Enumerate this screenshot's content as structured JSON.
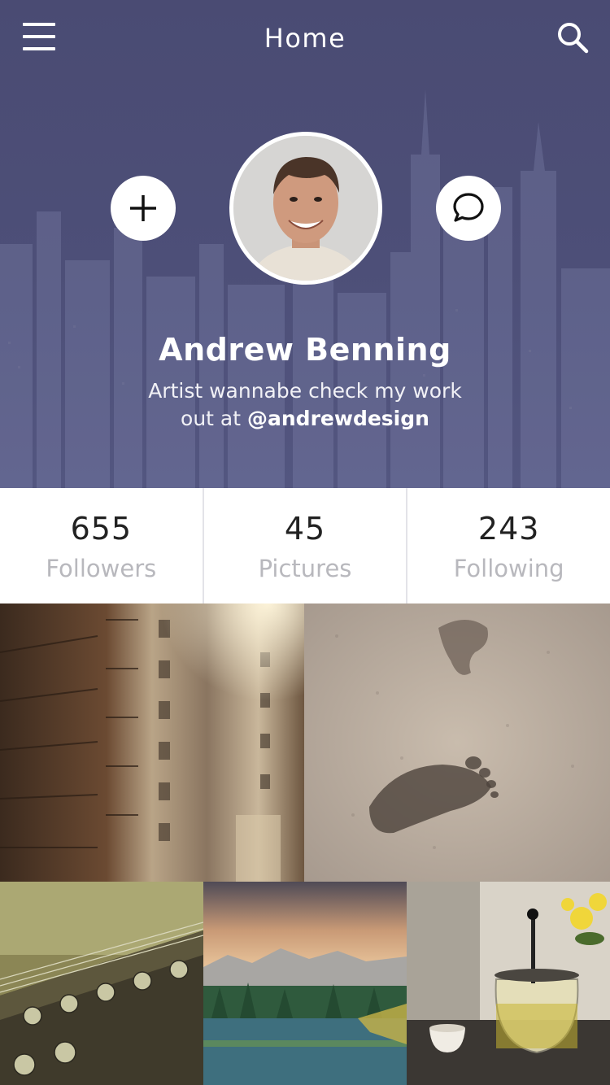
{
  "header": {
    "title": "Home",
    "menu_icon": "hamburger-menu-icon",
    "search_icon": "search-icon"
  },
  "profile": {
    "name": "Andrew Benning",
    "bio_line1": "Artist wannabe check my work",
    "bio_line2_prefix": "out at ",
    "handle": "@andrewdesign",
    "add_icon": "plus-icon",
    "chat_icon": "chat-bubble-icon"
  },
  "stats": [
    {
      "value": "655",
      "label": "Followers"
    },
    {
      "value": "45",
      "label": "Pictures"
    },
    {
      "value": "243",
      "label": "Following"
    }
  ],
  "gallery": [
    {
      "subject": "city-buildings-fire-escapes"
    },
    {
      "subject": "footprints-in-sand"
    },
    {
      "subject": "guitar-headstock"
    },
    {
      "subject": "mountain-lake-landscape"
    },
    {
      "subject": "teapot-with-flowers"
    }
  ],
  "colors": {
    "header_bg": "#4d4f78",
    "text_primary": "#222222",
    "text_muted": "#b8b8bd",
    "divider": "#e3e3e8"
  }
}
